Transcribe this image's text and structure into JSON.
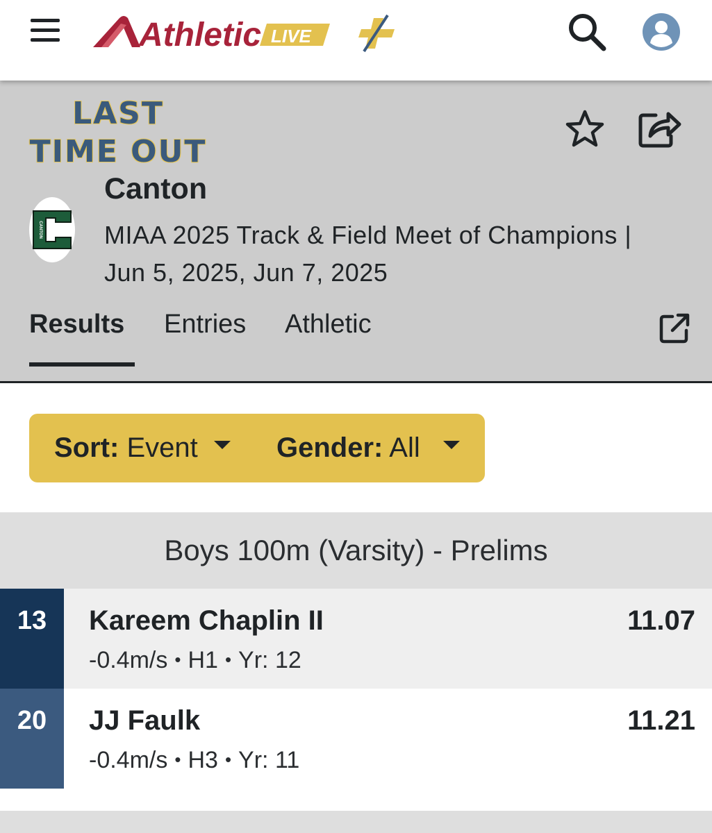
{
  "brand": {
    "name": "Athletic",
    "suffix": "LIVE",
    "accent": "#a8233a",
    "gold": "#e3c14f"
  },
  "header": {
    "program_title_line1": "LAST",
    "program_title_line2": "TIME OUT",
    "team_name": "Canton",
    "team_logo_letter": "C",
    "team_logo_text": "CANTON",
    "meet_line1": "MIAA 2025 Track & Field Meet of Champions |",
    "meet_line2": "Jun 5, 2025, Jun 7, 2025"
  },
  "tabs": [
    {
      "label": "Results",
      "active": true
    },
    {
      "label": "Entries",
      "active": false
    },
    {
      "label": "Athletic",
      "active": false,
      "external": true
    }
  ],
  "filters": {
    "sort_label": "Sort:",
    "sort_value": "Event",
    "gender_label": "Gender:",
    "gender_value": "All"
  },
  "event": {
    "title": "Boys 100m (Varsity) - Prelims"
  },
  "results": [
    {
      "place": "13",
      "name": "Kareem Chaplin II",
      "wind": "-0.4m/s",
      "heat": "H1",
      "year": "Yr: 12",
      "mark": "11.07"
    },
    {
      "place": "20",
      "name": "JJ Faulk",
      "wind": "-0.4m/s",
      "heat": "H3",
      "year": "Yr: 11",
      "mark": "11.21"
    }
  ],
  "icons": [
    "menu-icon",
    "search-icon",
    "user-icon",
    "star-icon",
    "share-icon",
    "external-link-icon",
    "chevron-down-icon"
  ]
}
